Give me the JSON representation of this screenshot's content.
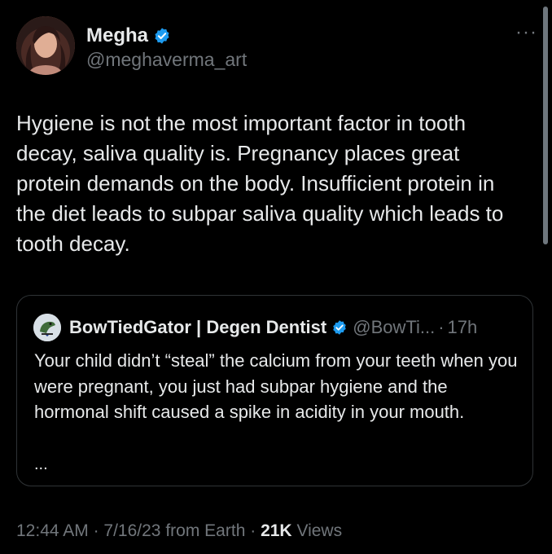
{
  "author": {
    "name": "Megha",
    "handle": "@meghaverma_art",
    "verified": true
  },
  "more_label": "···",
  "tweet": {
    "text": "Hygiene is not the most important factor in tooth decay, saliva quality is. Pregnancy places great protein demands on the body. Insufficient protein in the diet leads to subpar saliva quality which leads to tooth decay."
  },
  "quoted": {
    "name": "BowTiedGator | Degen Dentist",
    "handle": "@BowTi...",
    "separator": "·",
    "time": "17h",
    "text": "Your child didn’t “steal” the calcium from your teeth when you were pregnant, you just had subpar hygiene and the hormonal shift caused a spike in acidity in your mouth.",
    "ellipsis": "..."
  },
  "meta": {
    "time": "12:44 AM",
    "separator": "·",
    "date": "7/16/23",
    "source": "from Earth",
    "views_count": "21K",
    "views_label": "Views"
  },
  "colors": {
    "background": "#000000",
    "text": "#e7e9ea",
    "secondary": "#71767b",
    "verified": "#1d9bf0",
    "border": "#2f3336"
  }
}
